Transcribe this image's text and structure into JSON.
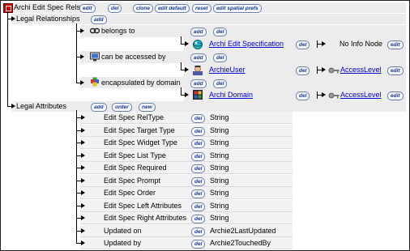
{
  "root": {
    "title": "Archi Edit Spec Rels",
    "buttons": [
      "edit",
      "del",
      "clone",
      "edit default",
      "reset",
      "edit spatial prefs"
    ]
  },
  "legal_relationships": {
    "label": "Legal Relationships",
    "add_label": "add"
  },
  "relations": [
    {
      "label": "belongs to",
      "buttons": [
        "add",
        "del"
      ],
      "target": "Archi Edit Specification",
      "target_buttons": [
        "del"
      ],
      "info": "No Info Node",
      "info_button": "edit"
    },
    {
      "label": "can be accessed by",
      "buttons": [
        "add",
        "del"
      ],
      "target": "ArchieUser",
      "target_buttons": [
        "del"
      ],
      "access": "AccessLevel",
      "access_button": "edit"
    },
    {
      "label": "encapsulated by domain",
      "buttons": [
        "add",
        "del"
      ],
      "target": "Archi Domain",
      "target_buttons": [
        "del"
      ],
      "access": "AccessLevel",
      "access_button": "edit"
    }
  ],
  "legal_attributes": {
    "label": "Legal Attributes",
    "buttons": [
      "add",
      "order",
      "new"
    ]
  },
  "attributes": [
    {
      "name": "Edit Spec RelType",
      "del": "del",
      "type": "String"
    },
    {
      "name": "Edit Spec Target Type",
      "del": "del",
      "type": "String"
    },
    {
      "name": "Edit Spec Widget Type",
      "del": "del",
      "type": "String"
    },
    {
      "name": "Edit Spec List Type",
      "del": "del",
      "type": "String"
    },
    {
      "name": "Edit Spec Required",
      "del": "del",
      "type": "String"
    },
    {
      "name": "Edit Spec Prompt",
      "del": "del",
      "type": "String"
    },
    {
      "name": "Edit Spec Order",
      "del": "del",
      "type": "String"
    },
    {
      "name": "Edit Spec Left Attributes",
      "del": "del",
      "type": "String"
    },
    {
      "name": "Edit Spec Right Attributes",
      "del": "del",
      "type": "String"
    },
    {
      "name": "Updated on",
      "del": "del",
      "type": "Archie2LastUpdated"
    },
    {
      "name": "Updated by",
      "del": "del",
      "type": "Archie2TouchedBy"
    }
  ],
  "icons": {
    "root": "node-icon",
    "belongs": "link-chain-icon",
    "access": "monitor-icon",
    "domain": "cube-icon",
    "spec": "sphere-object-icon",
    "user": "user-icon",
    "archi-domain": "domain-icon",
    "key": "key-icon"
  },
  "colors": {
    "link": "#0000cc",
    "band": "#ececec",
    "pill_border": "#6b7fa8",
    "pill_text": "#1e3c8c"
  }
}
